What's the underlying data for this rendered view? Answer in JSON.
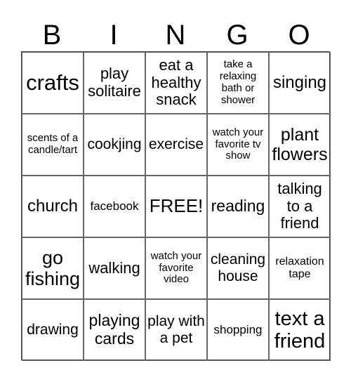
{
  "header": {
    "letters": [
      "B",
      "I",
      "N",
      "G",
      "O"
    ]
  },
  "cells": [
    [
      {
        "text": "crafts",
        "size": 31
      },
      {
        "text": "play solitaire",
        "size": 22
      },
      {
        "text": "eat a healthy snack",
        "size": 22
      },
      {
        "text": "take a relaxing bath or shower",
        "size": 15
      },
      {
        "text": "singing",
        "size": 24
      }
    ],
    [
      {
        "text": "scents of a candle/tart",
        "size": 15
      },
      {
        "text": "cookjing",
        "size": 21
      },
      {
        "text": "exercise",
        "size": 21
      },
      {
        "text": "watch your favorite tv show",
        "size": 15
      },
      {
        "text": "plant flowers",
        "size": 25
      }
    ],
    [
      {
        "text": "church",
        "size": 24
      },
      {
        "text": "facebook",
        "size": 17
      },
      {
        "text": "FREE!",
        "size": 26
      },
      {
        "text": "reading",
        "size": 23
      },
      {
        "text": "talking to a friend",
        "size": 22
      }
    ],
    [
      {
        "text": "go fishing",
        "size": 27
      },
      {
        "text": "walking",
        "size": 22
      },
      {
        "text": "watch your favorite video",
        "size": 15
      },
      {
        "text": "cleaning house",
        "size": 21
      },
      {
        "text": "relaxation tape",
        "size": 16
      }
    ],
    [
      {
        "text": "drawing",
        "size": 21
      },
      {
        "text": "playing cards",
        "size": 23
      },
      {
        "text": "play with a pet",
        "size": 21
      },
      {
        "text": "shopping",
        "size": 17
      },
      {
        "text": "text a friend",
        "size": 29
      }
    ]
  ]
}
